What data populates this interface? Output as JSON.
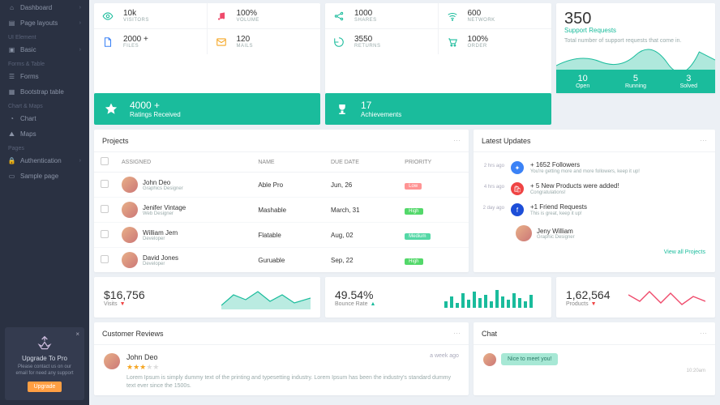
{
  "sidebar": {
    "items": [
      {
        "icon": "home",
        "label": "Dashboard",
        "expand": true
      },
      {
        "icon": "layout",
        "label": "Page layouts",
        "expand": true
      }
    ],
    "sections": [
      {
        "title": "UI Element",
        "items": [
          {
            "icon": "basic",
            "label": "Basic",
            "expand": true
          }
        ]
      },
      {
        "title": "Forms & Table",
        "items": [
          {
            "icon": "form",
            "label": "Forms"
          },
          {
            "icon": "table",
            "label": "Bootstrap table"
          }
        ]
      },
      {
        "title": "Chart & Maps",
        "items": [
          {
            "icon": "chart",
            "label": "Chart"
          },
          {
            "icon": "map",
            "label": "Maps"
          }
        ]
      },
      {
        "title": "Pages",
        "items": [
          {
            "icon": "lock",
            "label": "Authentication",
            "expand": true
          },
          {
            "icon": "page",
            "label": "Sample page"
          }
        ]
      }
    ],
    "upgrade": {
      "title": "Upgrade To Pro",
      "desc": "Please contact us on our email for need any support",
      "btn": "Upgrade"
    }
  },
  "stats_a": [
    {
      "icon": "eye",
      "color": "#1abc9c",
      "value": "10k",
      "label": "VISITORS"
    },
    {
      "icon": "music",
      "color": "#ef4a6b",
      "value": "100%",
      "label": "VOLUME"
    },
    {
      "icon": "file",
      "color": "#3b82f6",
      "value": "2000 +",
      "label": "FILES"
    },
    {
      "icon": "mail",
      "color": "#f5a623",
      "value": "120",
      "label": "MAILS"
    }
  ],
  "stats_b": [
    {
      "icon": "share",
      "color": "#1abc9c",
      "value": "1000",
      "label": "SHARES"
    },
    {
      "icon": "wifi",
      "color": "#1abc9c",
      "value": "600",
      "label": "NETWORK"
    },
    {
      "icon": "return",
      "color": "#1abc9c",
      "value": "3550",
      "label": "RETURNS"
    },
    {
      "icon": "cart",
      "color": "#1abc9c",
      "value": "100%",
      "label": "ORDER"
    }
  ],
  "banner_star": {
    "value": "4000 +",
    "label": "Ratings Received"
  },
  "banner_trophy": {
    "value": "17",
    "label": "Achievements"
  },
  "support": {
    "big": "350",
    "label": "Support Requests",
    "desc": "Total number of support requests that come in.",
    "tabs": [
      {
        "v": "10",
        "l": "Open"
      },
      {
        "v": "5",
        "l": "Running"
      },
      {
        "v": "3",
        "l": "Solved"
      }
    ]
  },
  "projects": {
    "title": "Projects",
    "cols": [
      "ASSIGNED",
      "NAME",
      "DUE DATE",
      "PRIORITY"
    ],
    "rows": [
      {
        "name": "John Deo",
        "role": "Graphics Designer",
        "proj": "Able Pro",
        "due": "Jun, 26",
        "p": "Low",
        "pc": "b-low"
      },
      {
        "name": "Jenifer Vintage",
        "role": "Web Designer",
        "proj": "Mashable",
        "due": "March, 31",
        "p": "High",
        "pc": "b-high"
      },
      {
        "name": "William Jem",
        "role": "Developer",
        "proj": "Flatable",
        "due": "Aug, 02",
        "p": "Medium",
        "pc": "b-med"
      },
      {
        "name": "David Jones",
        "role": "Developer",
        "proj": "Guruable",
        "due": "Sep, 22",
        "p": "High",
        "pc": "b-high"
      }
    ]
  },
  "updates": {
    "title": "Latest Updates",
    "items": [
      {
        "t": "2 hrs ago",
        "c": "bb-blue",
        "icon": "tw",
        "h": "+ 1652 Followers",
        "d": "You're getting more and more followers, keep it up!"
      },
      {
        "t": "4 hrs ago",
        "c": "bb-red",
        "icon": "cart",
        "h": "+ 5 New Products were added!",
        "d": "Congratulations!"
      },
      {
        "t": "2 day ago",
        "c": "bb-fb",
        "icon": "fb",
        "h": "+1 Friend Requests",
        "d": "This is great, keep it up!"
      }
    ],
    "friend": {
      "name": "Jeny William",
      "meta": "Graphic Designer"
    },
    "viewall": "View all Projects"
  },
  "minis": [
    {
      "v": "$16,756",
      "l": "Visits",
      "dir": "down",
      "spark": "area-green"
    },
    {
      "v": "49.54%",
      "l": "Bounce Rate",
      "dir": "up",
      "spark": "bars-green"
    },
    {
      "v": "1,62,564",
      "l": "Products",
      "dir": "down",
      "spark": "line-red"
    }
  ],
  "reviews": {
    "title": "Customer Reviews",
    "name": "John Deo",
    "stars": 3,
    "ago": "a week ago",
    "text": "Lorem Ipsum is simply dummy text of the printing and typesetting industry. Lorem Ipsum has been the industry's standard dummy text ever since the 1500s."
  },
  "chat": {
    "title": "Chat",
    "msg": "Nice to meet you!",
    "time": "10:20am"
  }
}
